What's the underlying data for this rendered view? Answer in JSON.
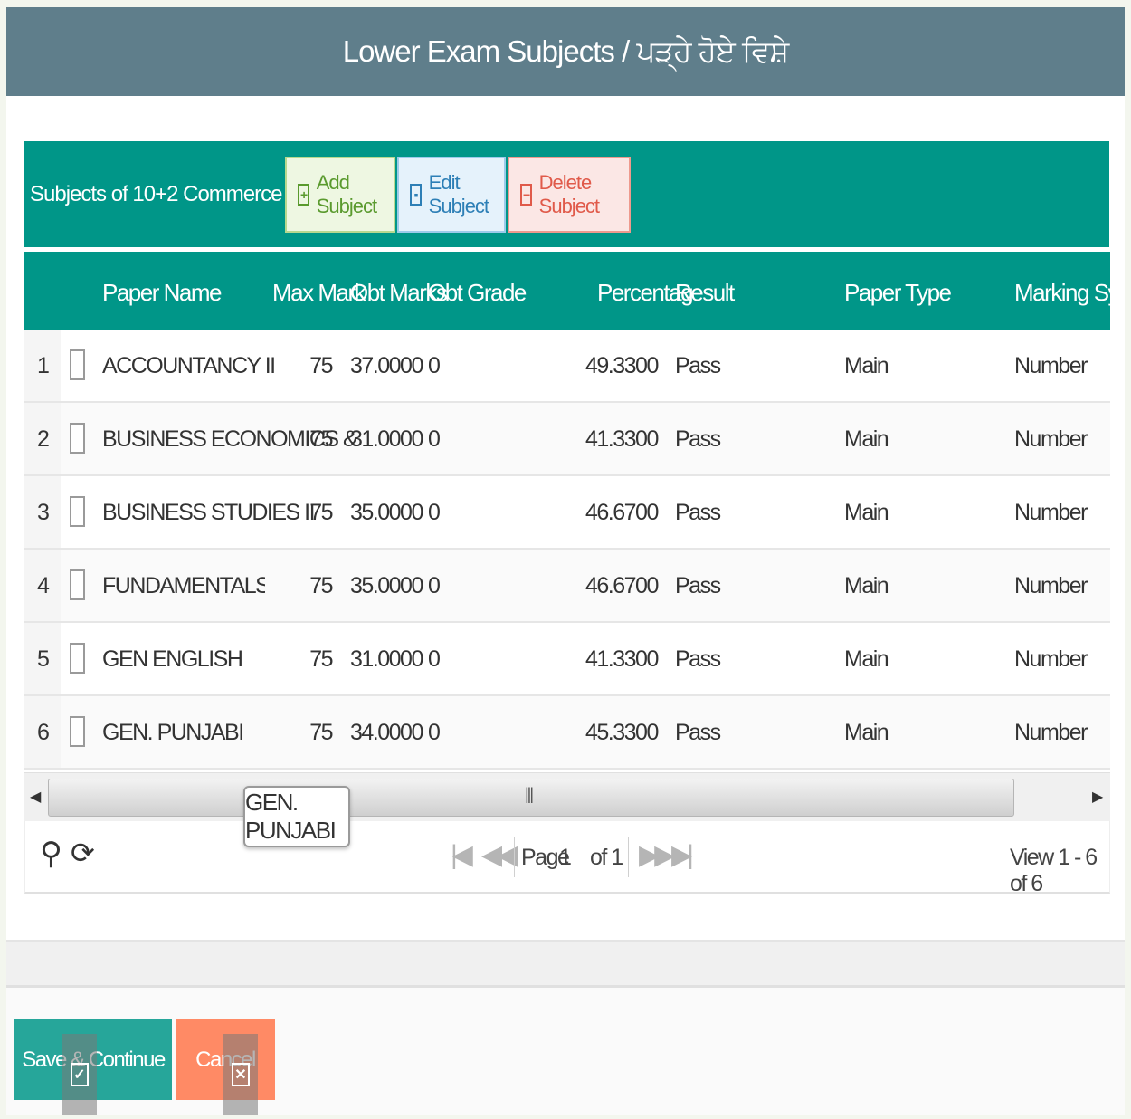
{
  "header": {
    "title": "Lower Exam Subjects / ਪੜ੍ਹੇ ਹੋਏ ਵਿਸ਼ੇ"
  },
  "toolbar": {
    "caption": "Subjects of 10+2 Commerce",
    "add_label": "Add Subject",
    "edit_label": "Edit Subject",
    "delete_label": "Delete Subject"
  },
  "columns": {
    "paper_name": "Paper Name",
    "max_mark": "Max Mark",
    "obt_marks": "Obt Marks",
    "obt_grade": "Obt Grade",
    "percentage": "Percentag",
    "result": "Result",
    "paper_type": "Paper Type",
    "marking_system": "Marking Systen"
  },
  "rows": [
    {
      "num": "1",
      "paper_name": "ACCOUNTANCY II",
      "max_mark": "75",
      "obt_marks": "37.0000",
      "obt_grade": "0",
      "percentage": "49.3300",
      "result": "Pass",
      "paper_type": "Main",
      "marking_system": "Number"
    },
    {
      "num": "2",
      "paper_name": "BUSINESS ECONOMICS &",
      "max_mark": "75",
      "obt_marks": "31.0000",
      "obt_grade": "0",
      "percentage": "41.3300",
      "result": "Pass",
      "paper_type": "Main",
      "marking_system": "Number"
    },
    {
      "num": "3",
      "paper_name": "BUSINESS STUDIES II",
      "max_mark": "75",
      "obt_marks": "35.0000",
      "obt_grade": "0",
      "percentage": "46.6700",
      "result": "Pass",
      "paper_type": "Main",
      "marking_system": "Number"
    },
    {
      "num": "4",
      "paper_name": "FUNDAMENTALS OF E-BU",
      "max_mark": "75",
      "obt_marks": "35.0000",
      "obt_grade": "0",
      "percentage": "46.6700",
      "result": "Pass",
      "paper_type": "Main",
      "marking_system": "Number"
    },
    {
      "num": "5",
      "paper_name": "GEN ENGLISH",
      "max_mark": "75",
      "obt_marks": "31.0000",
      "obt_grade": "0",
      "percentage": "41.3300",
      "result": "Pass",
      "paper_type": "Main",
      "marking_system": "Number"
    },
    {
      "num": "6",
      "paper_name": "GEN. PUNJABI",
      "max_mark": "75",
      "obt_marks": "34.0000",
      "obt_grade": "0",
      "percentage": "45.3300",
      "result": "Pass",
      "paper_type": "Main",
      "marking_system": "Number"
    }
  ],
  "pager": {
    "page_label": "Page",
    "page_value": "1",
    "of_label": "of 1",
    "view_text": "View 1 - 6 of 6"
  },
  "tooltip": {
    "text": "GEN. PUNJABI"
  },
  "footer": {
    "save_label": "Save & Continue",
    "cancel_label": "Cancel"
  },
  "icons": {
    "search": "search-icon",
    "refresh": "refresh-icon",
    "first": "first-page-icon",
    "prev": "prev-page-icon",
    "next": "next-page-icon",
    "last": "last-page-icon"
  },
  "colors": {
    "header_bg": "#5f7e8b",
    "grid_bg": "#009688",
    "save_bg": "#26a69a",
    "cancel_bg": "#ff8a65"
  }
}
